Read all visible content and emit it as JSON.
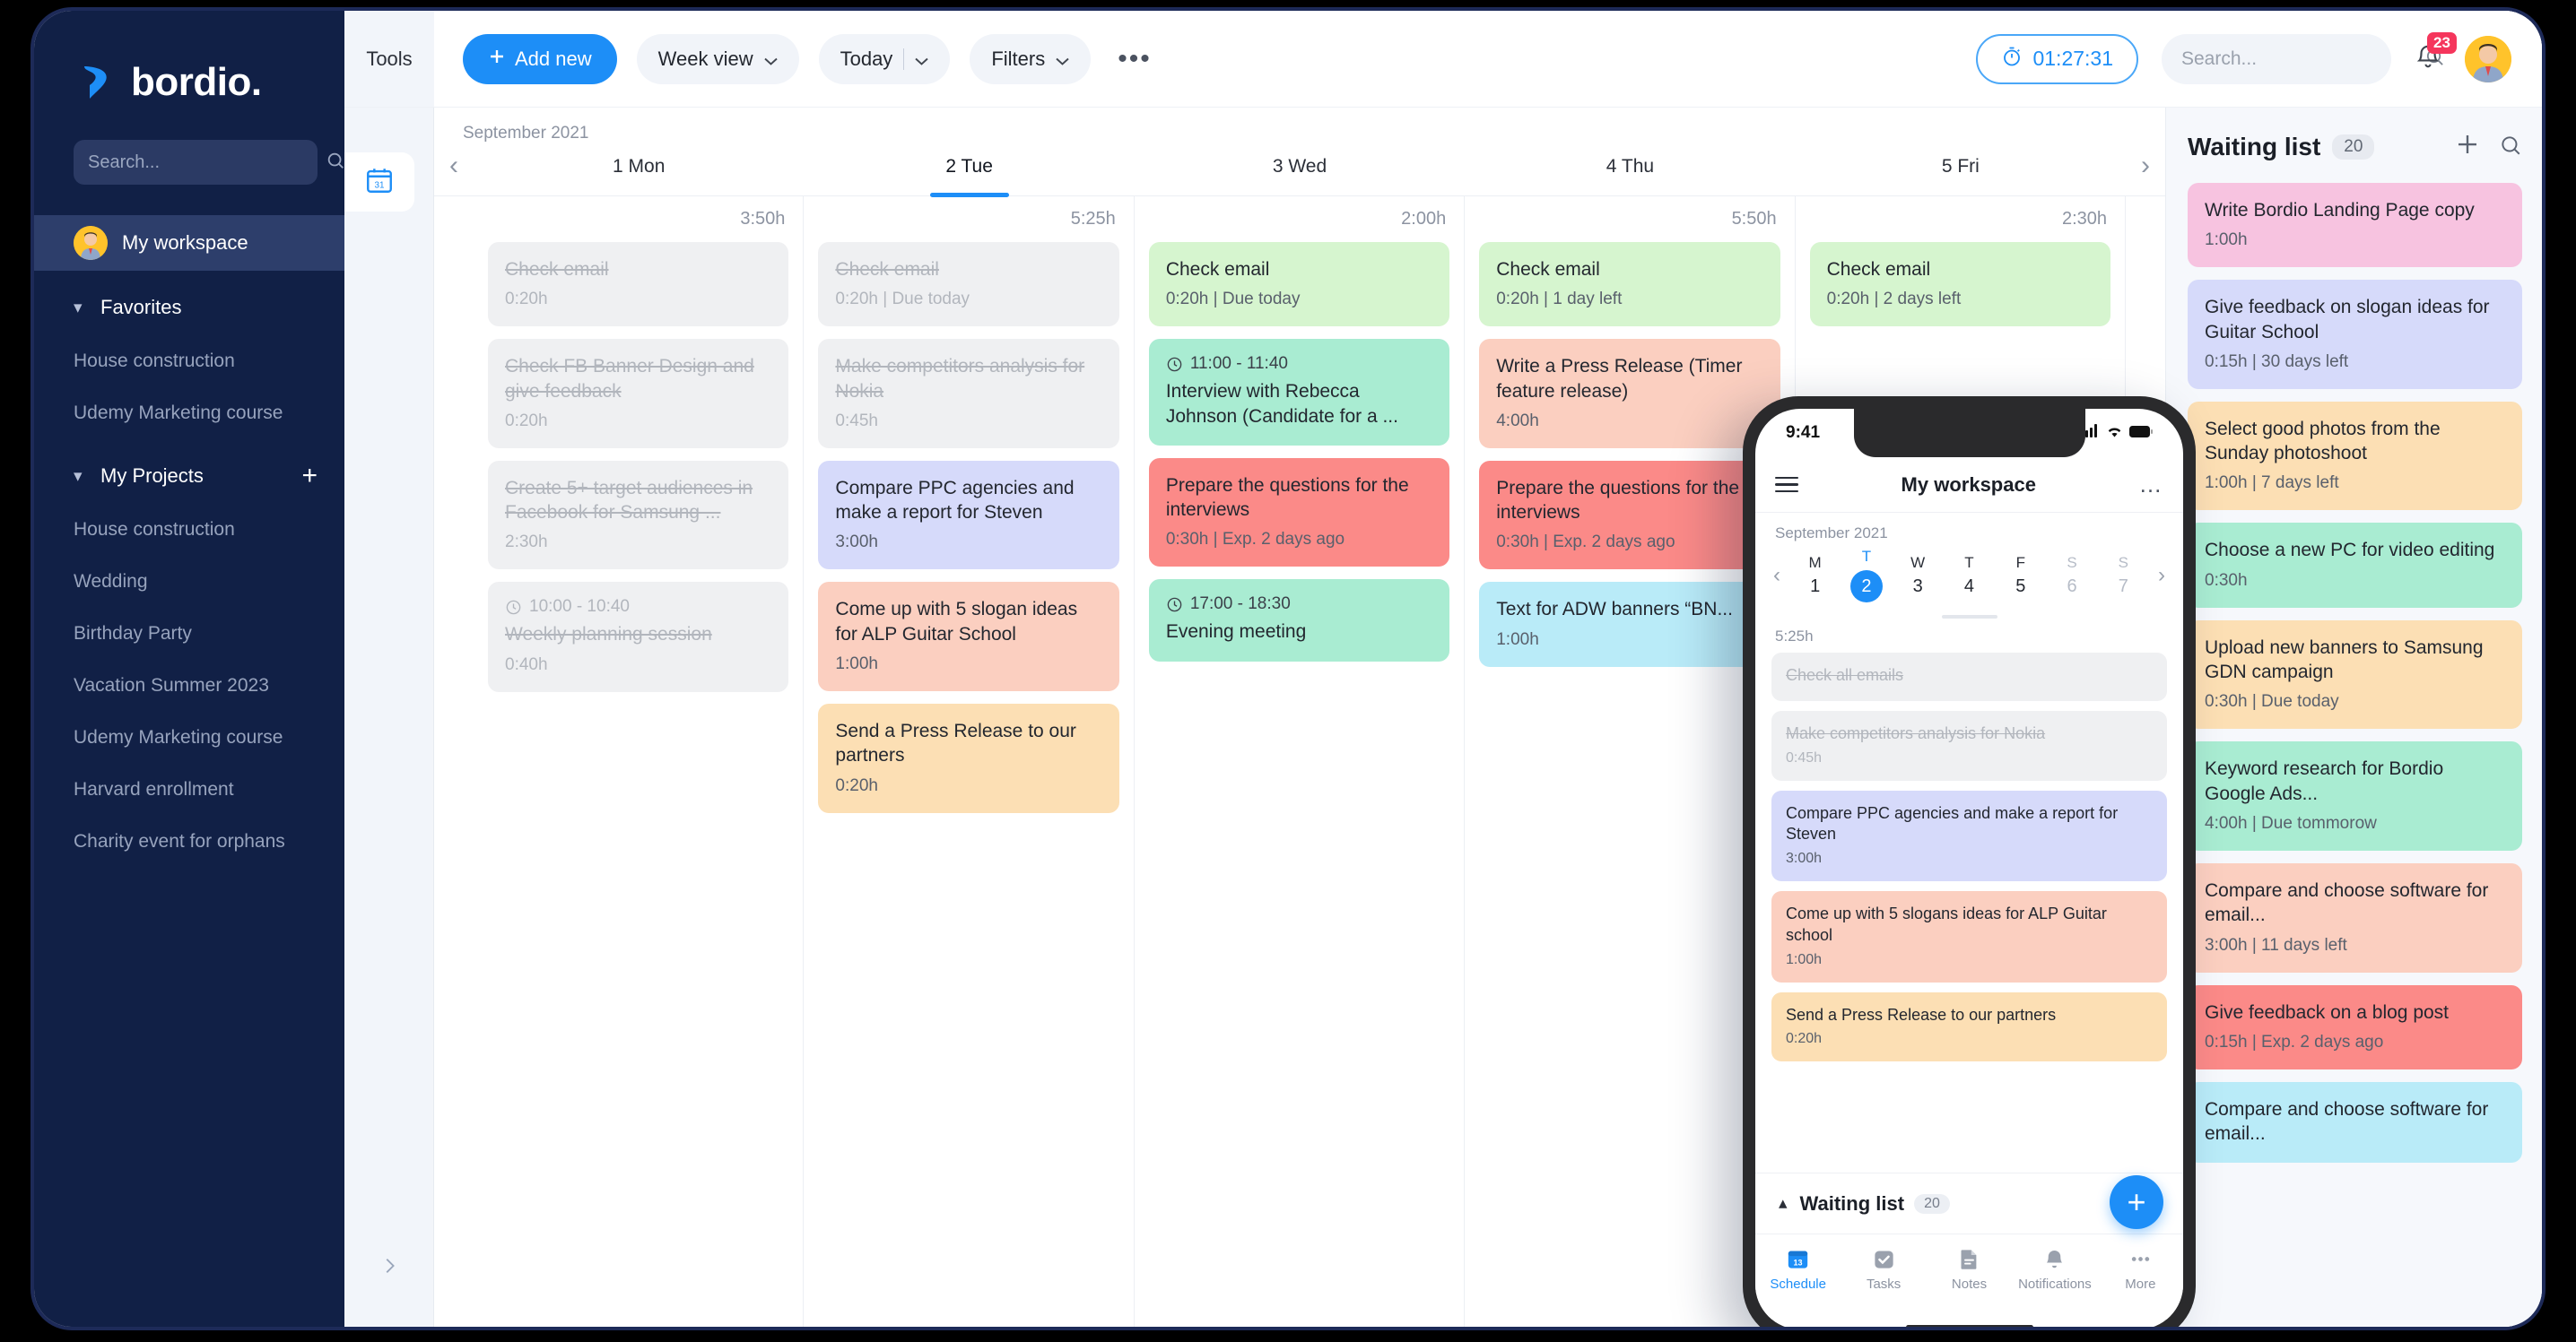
{
  "brand": {
    "name": "bordio.",
    "accent": "#1d8ef7",
    "sidebar_bg": "#112046"
  },
  "sidebar": {
    "search_placeholder": "Search...",
    "workspace": "My workspace",
    "favorites": {
      "label": "Favorites",
      "items": [
        "House construction",
        "Udemy Marketing course"
      ]
    },
    "projects": {
      "label": "My Projects",
      "add_label": "+",
      "items": [
        "House construction",
        "Wedding",
        "Birthday Party",
        "Vacation Summer 2023",
        "Udemy Marketing course",
        "Harvard enrollment",
        "Charity event for orphans"
      ]
    }
  },
  "rail": {
    "tools_label": "Tools",
    "calendar_icon_day": "31",
    "collapse_icon": "chevron-right"
  },
  "toolbar": {
    "add_new": "Add new",
    "view_select": "Week view",
    "today": "Today",
    "filters": "Filters",
    "more": "•••",
    "timer": "01:27:31",
    "search_placeholder": "Search...",
    "notification_count": "23"
  },
  "calendar": {
    "month": "September 2021",
    "prev": "‹",
    "next": "›",
    "days": [
      {
        "label": "1 Mon",
        "active": false,
        "total": "3:50h"
      },
      {
        "label": "2 Tue",
        "active": true,
        "total": "5:25h"
      },
      {
        "label": "3 Wed",
        "active": false,
        "total": "2:00h"
      },
      {
        "label": "4 Thu",
        "active": false,
        "total": "5:50h"
      },
      {
        "label": "5 Fri",
        "active": false,
        "total": "2:30h"
      }
    ],
    "columns": [
      {
        "tasks": [
          {
            "title": "Check email",
            "meta": "0:20h",
            "time": "",
            "color": "#eff0f2",
            "done": true
          },
          {
            "title": "Check FB Banner Design and give feedback",
            "meta": "0:20h",
            "time": "",
            "color": "#eff0f2",
            "done": true
          },
          {
            "title": "Create 5+ target audiences in Facebook for Samsung ...",
            "meta": "2:30h",
            "time": "",
            "color": "#eff0f2",
            "done": true
          },
          {
            "title": "Weekly planning session",
            "meta": "0:40h",
            "time": "10:00 - 10:40",
            "color": "#eff0f2",
            "done": true
          }
        ]
      },
      {
        "tasks": [
          {
            "title": "Check email",
            "meta": "0:20h | Due today",
            "time": "",
            "color": "#eff0f2",
            "done": true
          },
          {
            "title": "Make competitors analysis for Nokia",
            "meta": "0:45h",
            "time": "",
            "color": "#eff0f2",
            "done": true
          },
          {
            "title": "Compare PPC agencies and make a report for Steven",
            "meta": "3:00h",
            "time": "",
            "color": "#d6dafa",
            "done": false
          },
          {
            "title": "Come up with 5 slogan ideas for ALP Guitar School",
            "meta": "1:00h",
            "time": "",
            "color": "#fbcfc0",
            "done": false
          },
          {
            "title": "Send a Press Release to our partners",
            "meta": "0:20h",
            "time": "",
            "color": "#fcdfb4",
            "done": false
          }
        ]
      },
      {
        "tasks": [
          {
            "title": "Check email",
            "meta": "0:20h | Due today",
            "time": "",
            "color": "#d6f5cf",
            "done": false
          },
          {
            "title": "Interview with Rebecca Johnson (Candidate for a ...",
            "meta": "",
            "time": "11:00 - 11:40",
            "color": "#a9ecd2",
            "done": false
          },
          {
            "title": "Prepare the questions for the interviews",
            "meta": "0:30h | Exp. 2 days ago",
            "time": "",
            "color": "#fb8a88",
            "done": false
          },
          {
            "title": "Evening meeting",
            "meta": "",
            "time": "17:00 - 18:30",
            "color": "#a9ecd2",
            "done": false
          }
        ]
      },
      {
        "tasks": [
          {
            "title": "Check email",
            "meta": "0:20h | 1 day left",
            "time": "",
            "color": "#d6f5cf",
            "done": false
          },
          {
            "title": "Write a Press Release (Timer feature release)",
            "meta": "4:00h",
            "time": "",
            "color": "#fbcfc0",
            "done": false
          },
          {
            "title": "Prepare the questions for the interviews",
            "meta": "0:30h | Exp. 2 days ago",
            "time": "",
            "color": "#fb8a88",
            "done": false
          },
          {
            "title": "Text for ADW banners “BN...",
            "meta": "1:00h",
            "time": "",
            "color": "#b9ebf8",
            "done": false
          }
        ]
      },
      {
        "tasks": [
          {
            "title": "Check email",
            "meta": "0:20h | 2 days left",
            "time": "",
            "color": "#d6f5cf",
            "done": false
          }
        ]
      }
    ]
  },
  "waiting_list": {
    "title": "Waiting list",
    "count": "20",
    "add_icon": "plus-icon",
    "search_icon": "search-icon",
    "items": [
      {
        "title": "Write Bordio Landing Page copy",
        "meta": "1:00h",
        "color": "#f7c3e0"
      },
      {
        "title": "Give feedback on slogan ideas for Guitar School",
        "meta": "0:15h | 30 days left",
        "color": "#d6dafa"
      },
      {
        "title": "Select good photos from the Sunday photoshoot",
        "meta": "1:00h | 7 days left",
        "color": "#fcdfb4"
      },
      {
        "title": "Choose a new PC for video editing",
        "meta": "0:30h",
        "color": "#a9ecd2"
      },
      {
        "title": "Upload new banners to Samsung GDN campaign",
        "meta": "0:30h | Due today",
        "color": "#fcdfb4"
      },
      {
        "title": "Keyword research for Bordio Google Ads...",
        "meta": "4:00h | Due tommorow",
        "color": "#a9ecd2"
      },
      {
        "title": "Compare and choose software for email...",
        "meta": "3:00h | 11 days left",
        "color": "#fbcfc0"
      },
      {
        "title": "Give feedback on a blog post",
        "meta": "0:15h | Exp. 2 days ago",
        "color": "#fb8a88"
      },
      {
        "title": "Compare and choose software for email...",
        "meta": "",
        "color": "#b9ebf8"
      }
    ]
  },
  "phone": {
    "status_time": "9:41",
    "title": "My workspace",
    "month": "September 2021",
    "week": [
      {
        "dow": "M",
        "num": "1",
        "selected": false,
        "dim": false
      },
      {
        "dow": "T",
        "num": "2",
        "selected": true,
        "dim": false
      },
      {
        "dow": "W",
        "num": "3",
        "selected": false,
        "dim": false
      },
      {
        "dow": "T",
        "num": "4",
        "selected": false,
        "dim": false
      },
      {
        "dow": "F",
        "num": "5",
        "selected": false,
        "dim": false
      },
      {
        "dow": "S",
        "num": "6",
        "selected": false,
        "dim": true
      },
      {
        "dow": "S",
        "num": "7",
        "selected": false,
        "dim": true
      }
    ],
    "day_total": "5:25h",
    "tasks": [
      {
        "title": "Check all emails",
        "meta": "",
        "color": "#eff0f2",
        "done": true
      },
      {
        "title": "Make competitors analysis for Nokia",
        "meta": "0:45h",
        "color": "#eff0f2",
        "done": true
      },
      {
        "title": "Compare PPC agencies and make a report for Steven",
        "meta": "3:00h",
        "color": "#d6dafa",
        "done": false
      },
      {
        "title": "Come up with 5 slogans ideas for ALP Guitar school",
        "meta": "1:00h",
        "color": "#fbcfc0",
        "done": false
      },
      {
        "title": "Send a Press Release to our partners",
        "meta": "0:20h",
        "color": "#fcdfb4",
        "done": false
      }
    ],
    "waiting_title": "Waiting list",
    "waiting_count": "20",
    "fab": "+",
    "tabs": [
      {
        "label": "Schedule",
        "icon": "calendar-icon",
        "active": true
      },
      {
        "label": "Tasks",
        "icon": "check-square-icon",
        "active": false
      },
      {
        "label": "Notes",
        "icon": "note-icon",
        "active": false
      },
      {
        "label": "Notifications",
        "icon": "bell-icon",
        "active": false
      },
      {
        "label": "More",
        "icon": "more-dots-icon",
        "active": false
      }
    ]
  }
}
